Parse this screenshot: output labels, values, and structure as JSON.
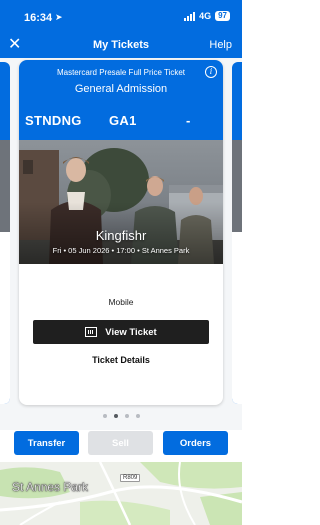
{
  "status_bar": {
    "time": "16:34",
    "network": "4G",
    "battery": "97"
  },
  "header": {
    "title": "My Tickets",
    "help_label": "Help"
  },
  "ticket": {
    "presale_label": "Mastercard Presale Full Price Ticket",
    "admission_type": "General Admission",
    "section": "STNDNG",
    "row": "GA1",
    "seat": "-",
    "artist": "Kingfishr",
    "event_meta": "Fri • 05 Jun 2026 • 17:00 • St Annes Park",
    "delivery_label": "Mobile",
    "view_ticket_label": "View Ticket",
    "details_label": "Ticket Details"
  },
  "carousel": {
    "count": 4,
    "active_index": 1
  },
  "actions": {
    "transfer_label": "Transfer",
    "sell_label": "Sell",
    "orders_label": "Orders"
  },
  "map": {
    "place_label": "St Annes Park",
    "road_label": "R809"
  },
  "colors": {
    "brand_blue": "#026cdf",
    "button_dark": "#1f1f1f",
    "disabled_gray": "#dfe1e4"
  },
  "icons": {
    "close": "close-icon",
    "info": "info-icon",
    "barcode": "barcode-icon",
    "location": "location-arrow-icon"
  }
}
